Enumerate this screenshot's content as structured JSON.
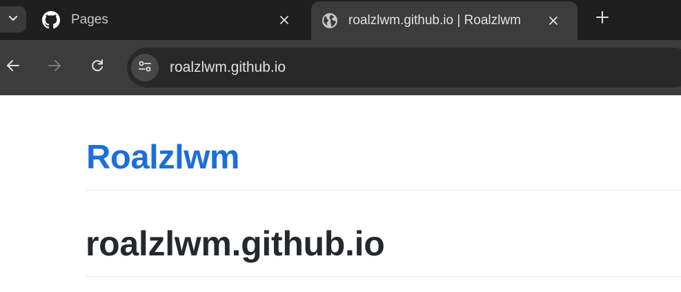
{
  "browser": {
    "tabs": [
      {
        "title": "Pages",
        "icon": "github-icon",
        "active": false
      },
      {
        "title": "roalzlwm.github.io | Roalzlwm",
        "icon": "globe-icon",
        "active": true
      }
    ],
    "address_bar": {
      "url": "roalzlwm.github.io"
    }
  },
  "page": {
    "site_title": "Roalzlwm",
    "heading": "roalzlwm.github.io"
  },
  "colors": {
    "tabbar_bg": "#1f1f1f",
    "toolbar_bg": "#3c3c3c",
    "link_blue": "#1c6fd9",
    "heading_text": "#24292e"
  }
}
